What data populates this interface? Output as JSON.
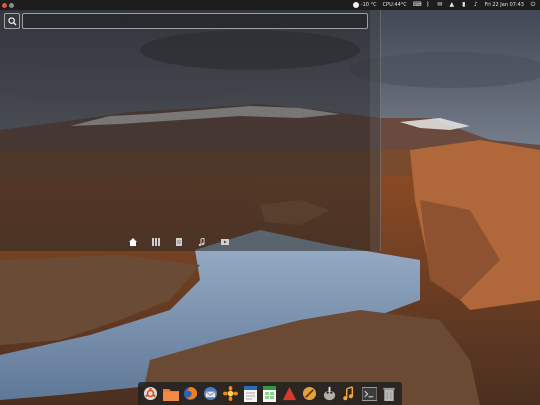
{
  "panel": {
    "weather": "-10 °C",
    "cpu_temp": "CPU:44°C",
    "clock": "Fri 22 Jan 07:43"
  },
  "dash": {
    "search": {
      "value": "",
      "placeholder": ""
    },
    "lenses": [
      {
        "name": "home-icon",
        "active": true
      },
      {
        "name": "applications-icon",
        "active": false
      },
      {
        "name": "files-icon",
        "active": false
      },
      {
        "name": "music-icon",
        "active": false
      },
      {
        "name": "video-icon",
        "active": false
      }
    ]
  },
  "dock": {
    "items": [
      {
        "name": "ubuntu-launcher-icon"
      },
      {
        "name": "files-folder-icon"
      },
      {
        "name": "firefox-icon"
      },
      {
        "name": "thunderbird-icon"
      },
      {
        "name": "photos-icon"
      },
      {
        "name": "writer-document-icon"
      },
      {
        "name": "calc-spreadsheet-icon"
      },
      {
        "name": "impress-presentation-icon"
      },
      {
        "name": "text-editor-icon"
      },
      {
        "name": "gimp-icon"
      },
      {
        "name": "music-player-icon"
      },
      {
        "name": "terminal-icon"
      },
      {
        "name": "trash-icon"
      }
    ]
  },
  "colors": {
    "panel_bg": "#1d1d1d",
    "dash_overlay": "#282828",
    "close_button": "#e2553d"
  }
}
